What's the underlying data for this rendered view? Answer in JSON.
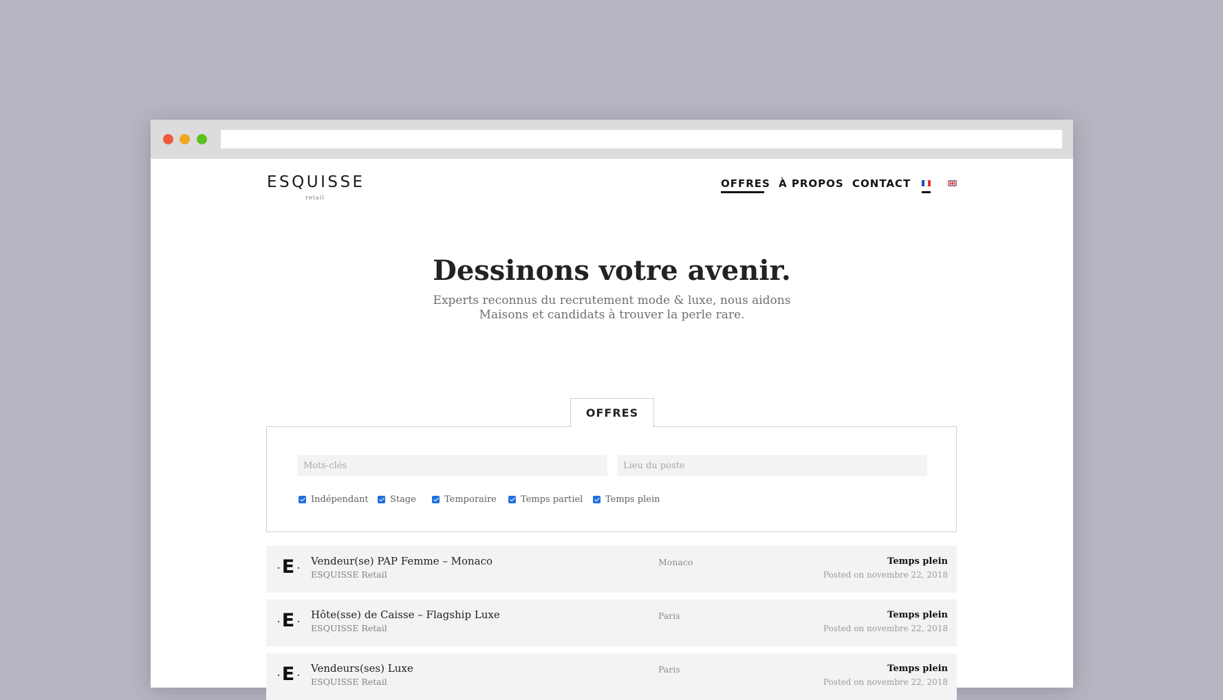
{
  "browser": {
    "traffic_lights": {
      "red": "#f05a3c",
      "yellow": "#f0a81e",
      "green": "#5ec21e"
    },
    "url": ""
  },
  "brand": {
    "name": "ESQUISSE",
    "tagline": "retail"
  },
  "nav": {
    "items": [
      {
        "label": "OFFRES",
        "active": true
      },
      {
        "label": "À PROPOS",
        "active": false
      },
      {
        "label": "CONTACT",
        "active": false
      }
    ],
    "languages": [
      {
        "icon": "flag-fr-icon",
        "active": true
      },
      {
        "icon": "flag-uk-icon",
        "active": false
      }
    ]
  },
  "hero": {
    "title": "Dessinons votre avenir.",
    "subtitle_line1": "Experts reconnus du recrutement mode & luxe, nous aidons",
    "subtitle_line2": "Maisons et candidats à trouver la perle rare."
  },
  "offers": {
    "tab_label": "OFFRES",
    "keywords_placeholder": "Mots-clés",
    "location_placeholder": "Lieu du poste",
    "filters": [
      {
        "label": "Indépendant",
        "checked": true
      },
      {
        "label": "Stage",
        "checked": true
      },
      {
        "label": "Temporaire",
        "checked": true
      },
      {
        "label": "Temps partiel",
        "checked": true
      },
      {
        "label": "Temps plein",
        "checked": true
      }
    ],
    "jobs": [
      {
        "logo": "E",
        "title": "Vendeur(se) PAP Femme – Monaco",
        "company": "ESQUISSE Retail",
        "location": "Monaco",
        "type": "Temps plein",
        "date": "Posted on novembre 22, 2018"
      },
      {
        "logo": "E",
        "title": "Hôte(sse) de Caisse – Flagship Luxe",
        "company": "ESQUISSE Retail",
        "location": "Paris",
        "type": "Temps plein",
        "date": "Posted on novembre 22, 2018"
      },
      {
        "logo": "E",
        "title": "Vendeurs(ses) Luxe",
        "company": "ESQUISSE Retail",
        "location": "Paris",
        "type": "Temps plein",
        "date": "Posted on novembre 22, 2018"
      }
    ]
  }
}
